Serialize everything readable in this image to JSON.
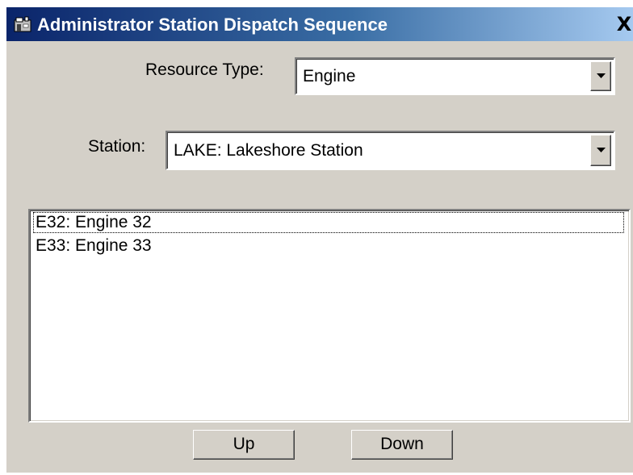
{
  "window": {
    "title": "Administrator Station Dispatch Sequence",
    "title_icon": "station-icon",
    "close_label": "X"
  },
  "resource_type": {
    "label": "Resource Type:",
    "value": "Engine"
  },
  "station": {
    "label": "Station:",
    "value": "LAKE: Lakeshore Station"
  },
  "list": {
    "items": [
      {
        "label": "E32: Engine 32",
        "focused": true
      },
      {
        "label": "E33: Engine 33",
        "focused": false
      }
    ]
  },
  "buttons": {
    "up_label": "Up",
    "down_label": "Down"
  },
  "colors": {
    "titlebar_start": "#0a246a",
    "titlebar_end": "#a6caf0",
    "dialog_face": "#d4d0c8"
  }
}
